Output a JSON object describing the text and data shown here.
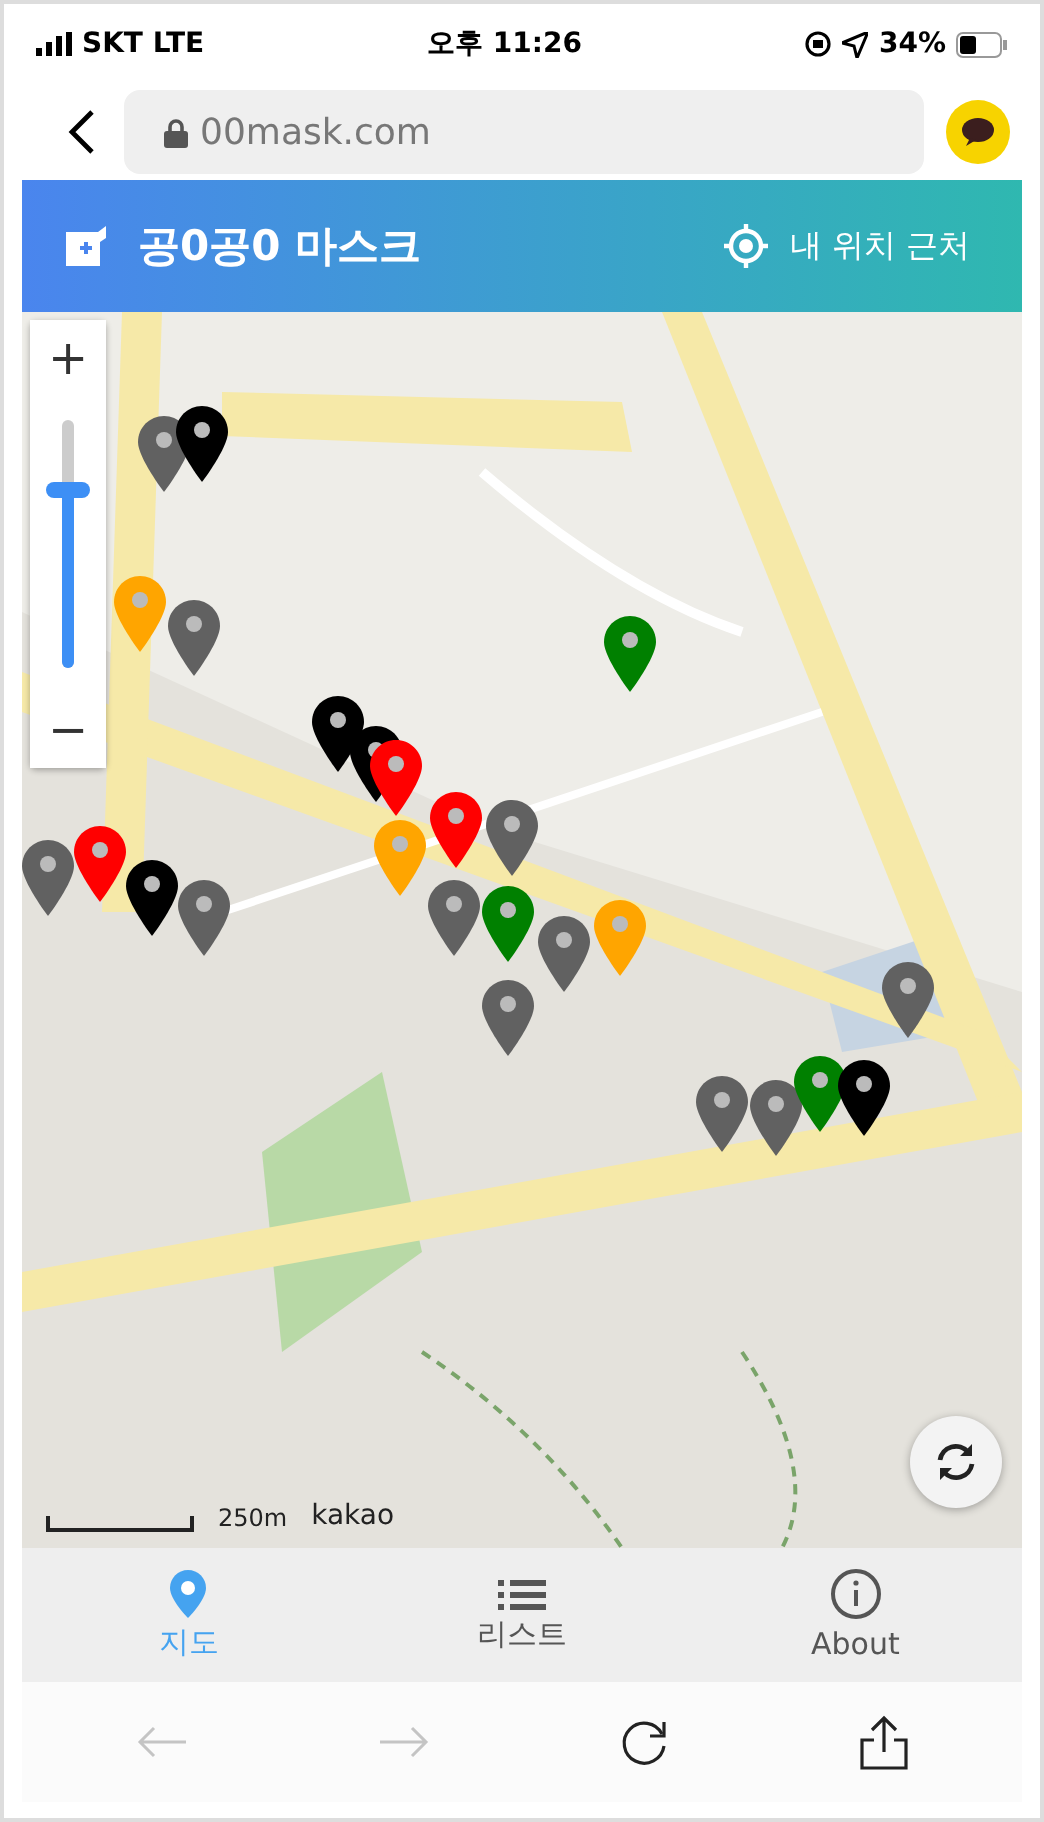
{
  "status_bar": {
    "carrier": "SKT LTE",
    "time": "오후 11:26",
    "battery": "34%"
  },
  "browser": {
    "url": "00mask.com"
  },
  "header": {
    "title": "공0공0 마스크",
    "nearby": "내 위치 근처"
  },
  "map": {
    "zoom": {
      "plus": "+",
      "minus": "−",
      "level": 0.72
    },
    "scale": "250m",
    "attribution": "kakao",
    "pins": [
      {
        "color": "#616161"
      },
      {
        "color": "#000000"
      },
      {
        "color": "#ffa500"
      },
      {
        "color": "#616161"
      },
      {
        "color": "#008000"
      },
      {
        "color": "#000000"
      },
      {
        "color": "#000000"
      },
      {
        "color": "#ff0000"
      },
      {
        "color": "#616161"
      },
      {
        "color": "#ff0000"
      },
      {
        "color": "#000000"
      },
      {
        "color": "#616161"
      },
      {
        "color": "#ffa500"
      },
      {
        "color": "#616161"
      },
      {
        "color": "#ff0000"
      },
      {
        "color": "#616161"
      },
      {
        "color": "#008000"
      },
      {
        "color": "#616161"
      },
      {
        "color": "#ffa500"
      },
      {
        "color": "#616161"
      },
      {
        "color": "#616161"
      },
      {
        "color": "#616161"
      },
      {
        "color": "#616161"
      },
      {
        "color": "#008000"
      },
      {
        "color": "#000000"
      }
    ]
  },
  "tabs": [
    {
      "label": "지도",
      "kind": "map",
      "selected": true
    },
    {
      "label": "리스트",
      "kind": "list",
      "selected": false
    },
    {
      "label": "About",
      "kind": "about",
      "selected": false
    }
  ],
  "toolbar": {
    "back_disabled": true,
    "forward_disabled": true
  }
}
